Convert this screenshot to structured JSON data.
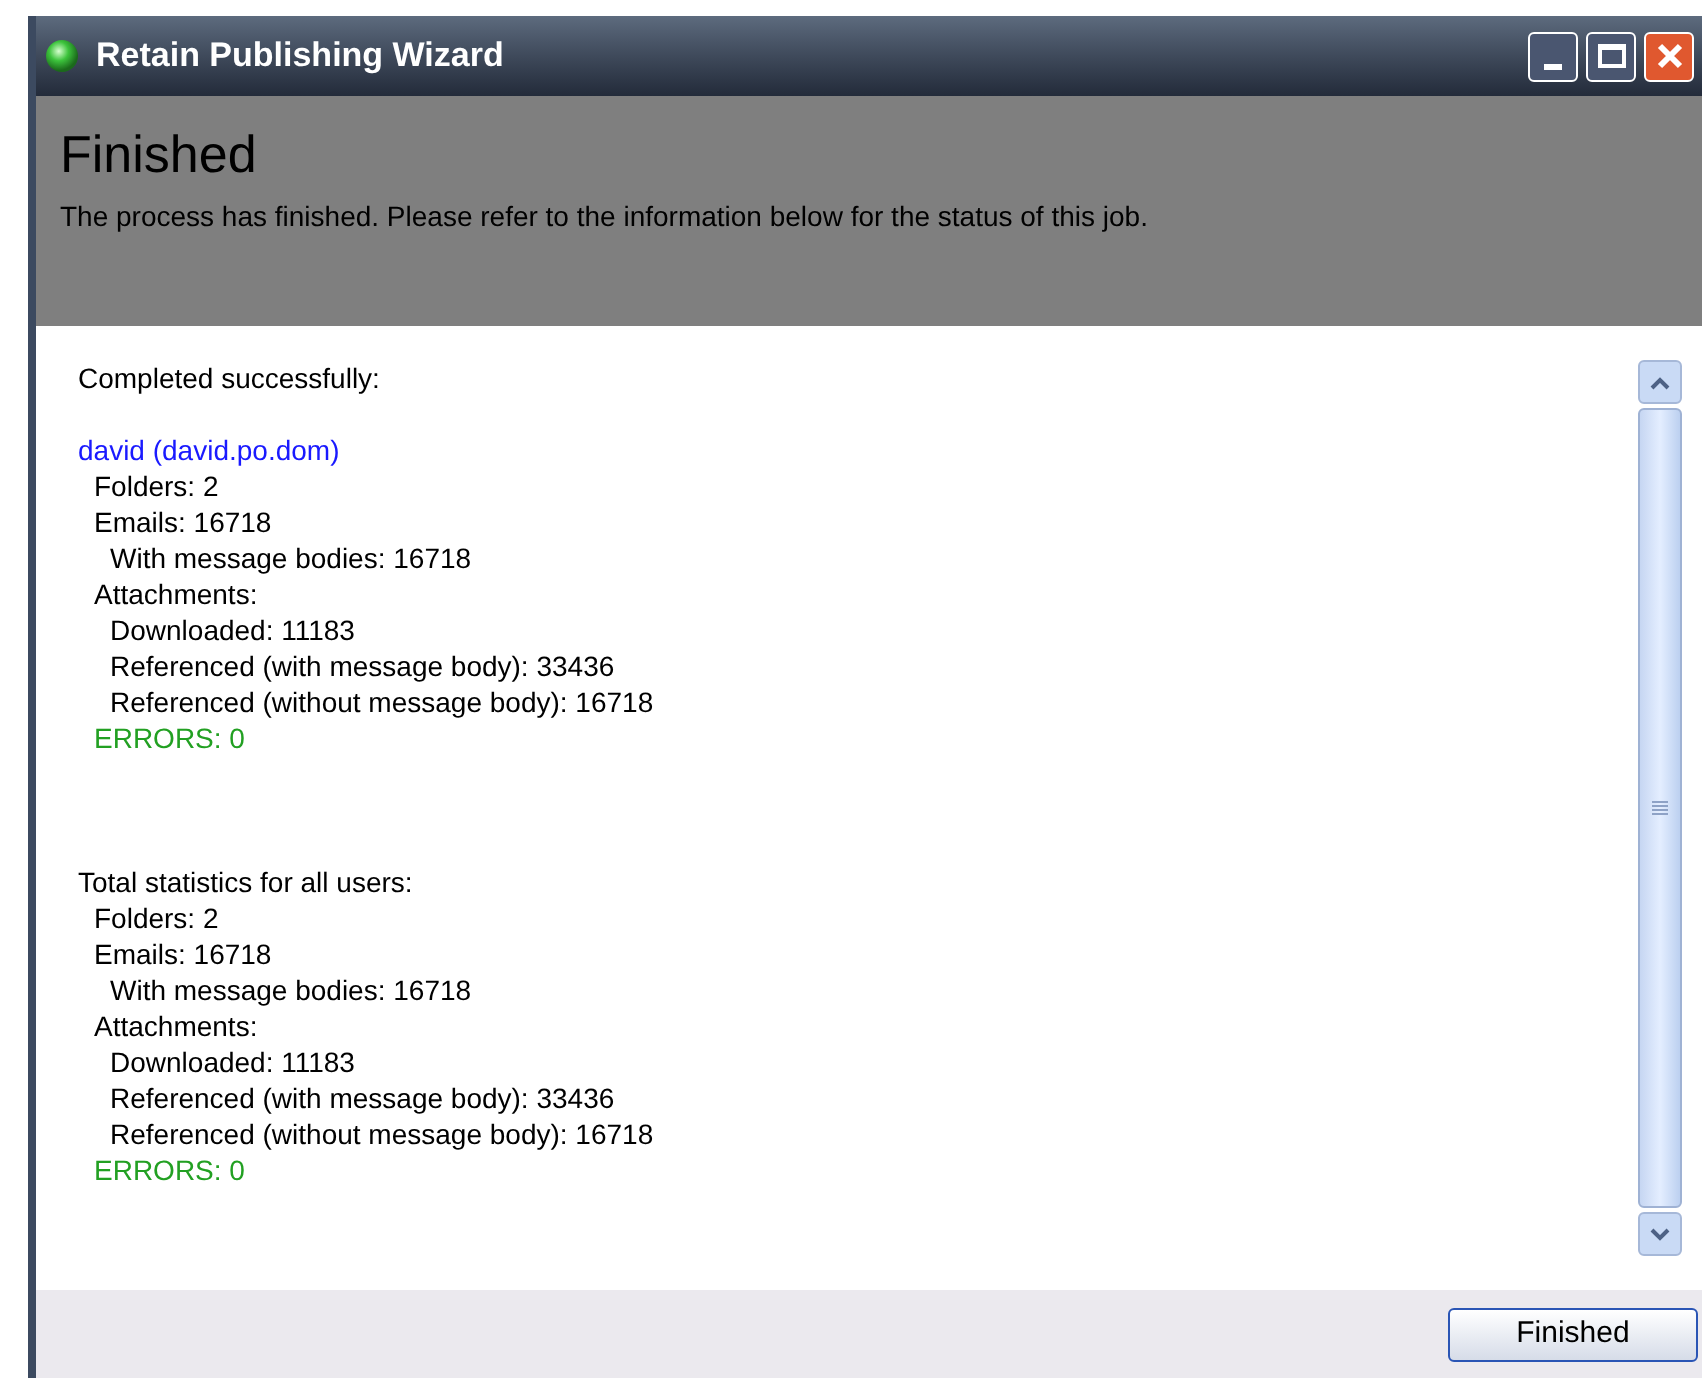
{
  "window": {
    "title": "Retain Publishing Wizard"
  },
  "header": {
    "title": "Finished",
    "description": "The process has finished. Please refer to the information below for the status of this job."
  },
  "report": [
    {
      "text": "Completed successfully:"
    },
    {
      "text": "david (david.po.dom)",
      "kind": "user",
      "children": [
        {
          "text": "Folders: 2"
        },
        {
          "text": "Emails: 16718",
          "children": [
            {
              "text": "With message bodies: 16718"
            }
          ]
        },
        {
          "text": "Attachments:",
          "children": [
            {
              "text": "Downloaded: 11183"
            },
            {
              "text": "Referenced (with message body): 33436"
            },
            {
              "text": "Referenced (without message body): 16718"
            }
          ]
        },
        {
          "text": "ERRORS: 0",
          "kind": "errors"
        }
      ]
    },
    {
      "text": "Total statistics for all users:",
      "kind": "summary",
      "children": [
        {
          "text": "Folders: 2"
        },
        {
          "text": "Emails: 16718",
          "children": [
            {
              "text": "With message bodies: 16718"
            }
          ]
        },
        {
          "text": "Attachments:",
          "children": [
            {
              "text": "Downloaded: 11183"
            },
            {
              "text": "Referenced (with message body): 33436"
            },
            {
              "text": "Referenced (without message body): 16718"
            }
          ]
        },
        {
          "text": "ERRORS: 0",
          "kind": "errors"
        }
      ]
    }
  ],
  "buttons": [
    "Finished"
  ]
}
